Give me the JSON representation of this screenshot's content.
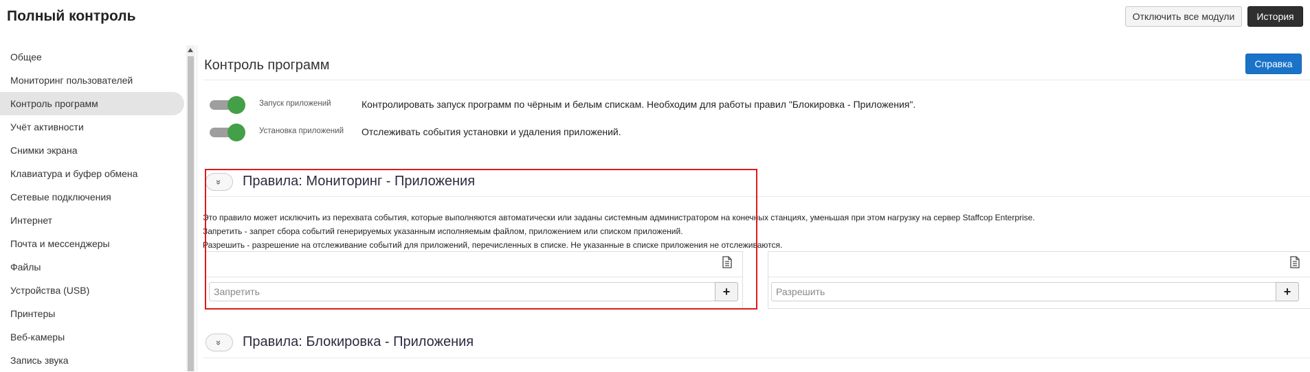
{
  "header": {
    "title": "Полный контроль",
    "disable_all_label": "Отключить все модули",
    "history_label": "История"
  },
  "sidebar": {
    "items": [
      {
        "label": "Общее"
      },
      {
        "label": "Мониторинг пользователей"
      },
      {
        "label": "Контроль программ",
        "active": true
      },
      {
        "label": "Учёт активности"
      },
      {
        "label": "Снимки экрана"
      },
      {
        "label": "Клавиатура и буфер обмена"
      },
      {
        "label": "Сетевые подключения"
      },
      {
        "label": "Интернет"
      },
      {
        "label": "Почта и мессенджеры"
      },
      {
        "label": "Файлы"
      },
      {
        "label": "Устройства (USB)"
      },
      {
        "label": "Принтеры"
      },
      {
        "label": "Веб-камеры"
      },
      {
        "label": "Запись звука"
      }
    ]
  },
  "main": {
    "section_title": "Контроль программ",
    "help_label": "Справка",
    "toggles": [
      {
        "label": "Запуск приложений",
        "on": true,
        "description": "Контролировать запуск программ по чёрным и белым спискам. Необходим для работы правил \"Блокировка - Приложения\"."
      },
      {
        "label": "Установка приложений",
        "on": true,
        "description": "Отслеживать события установки и удаления приложений."
      }
    ],
    "rule_monitoring": {
      "title": "Правила: Мониторинг - Приложения",
      "description_lines": [
        "Это правило может исключить из перехвата события, которые выполняются автоматически или заданы системным администратором на конечных станциях, уменьшая при этом нагрузку на сервер Staffcop Enterprise.",
        "Запретить - запрет сбора событий генерируемых указанным исполняемым файлом, приложением или списком приложений.",
        "Разрешить - разрешение на отслеживание событий для приложений, перечисленных в списке. Не указанные в списке приложения не отслеживаются."
      ],
      "deny_placeholder": "Запретить",
      "allow_placeholder": "Разрешить",
      "add_symbol": "+"
    },
    "rule_blocking": {
      "title": "Правила: Блокировка - Приложения"
    }
  },
  "colors": {
    "toggle_on": "#43a047",
    "help_button": "#1a73c9",
    "history_button": "#2f2f2f",
    "highlight": "#e01818"
  },
  "icons": {
    "collapse": "double-chevron-down-icon",
    "document": "document-icon",
    "add": "plus-icon"
  }
}
